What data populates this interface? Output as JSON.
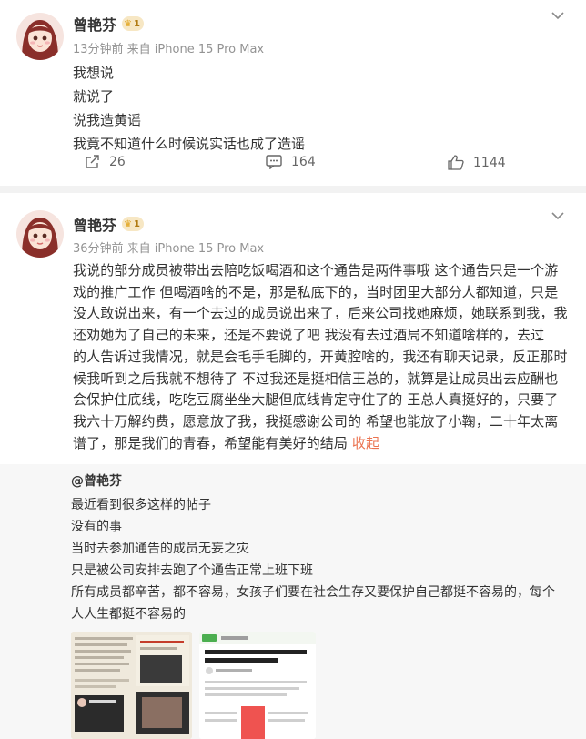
{
  "posts": [
    {
      "username": "曾艳芬",
      "vip_level": "1",
      "meta": "13分钟前  来自 iPhone 15 Pro Max",
      "lines": [
        "我想说",
        "就说了",
        "说我造黄谣",
        "我竟不知道什么时候说实话也成了造谣"
      ],
      "repost_count": "26",
      "comment_count": "164",
      "like_count": "1144"
    },
    {
      "username": "曾艳芬",
      "vip_level": "1",
      "meta": "36分钟前  来自 iPhone 15 Pro Max",
      "long_lines": [
        "我说的部分成员被带出去陪吃饭喝酒和这个通告是两件事哦 这个通告只是一个游",
        "戏的推广工作 但喝酒啥的不是，那是私底下的，当时团里大部分人都知道，只是",
        "没人敢说出来，有一个去过的成员说出来了，后来公司找她麻烦，她联系到我，我",
        "还劝她为了自己的未来，还是不要说了吧 我没有去过酒局不知道啥样的，去过",
        "的人告诉过我情况，就是会毛手毛脚的，开黄腔啥的，我还有聊天记录，反正那时",
        "候我听到之后我就不想待了 不过我还是挺相信王总的，就算是让成员出去应酬也",
        "会保护住底线，吃吃豆腐坐坐大腿但底线肯定守住了的 王总人真挺好的，只要了",
        "我六十万解约费，愿意放了我，我挺感谢公司的 希望也能放了小鞠，二十年太离",
        "谱了，那是我们的青春，希望能有美好的结局"
      ],
      "collapse_label": "收起",
      "retweet": {
        "author": "@曾艳芬",
        "lines": [
          "最近看到很多这样的帖子",
          "没有的事",
          "当时去参加通告的成员无妄之灾",
          "只是被公司安排去跑了个通告正常上班下班",
          "所有成员都辛苦，都不容易，女孩子们要在社会生存又要保护自己都挺不容易的，每个",
          "人人生都挺不容易的"
        ],
        "thumb2_title": "澄清！所谓的王恩聪喊snh吉生日免女部事件完全是假！"
      }
    }
  ],
  "colors": {
    "accent": "#eb7350",
    "vip_bg": "#f7e7c4",
    "meta_gray": "#939393"
  },
  "icons": {
    "repost": "repost-icon",
    "comment": "comment-icon",
    "like": "like-icon",
    "menu": "chevron-down-icon"
  }
}
